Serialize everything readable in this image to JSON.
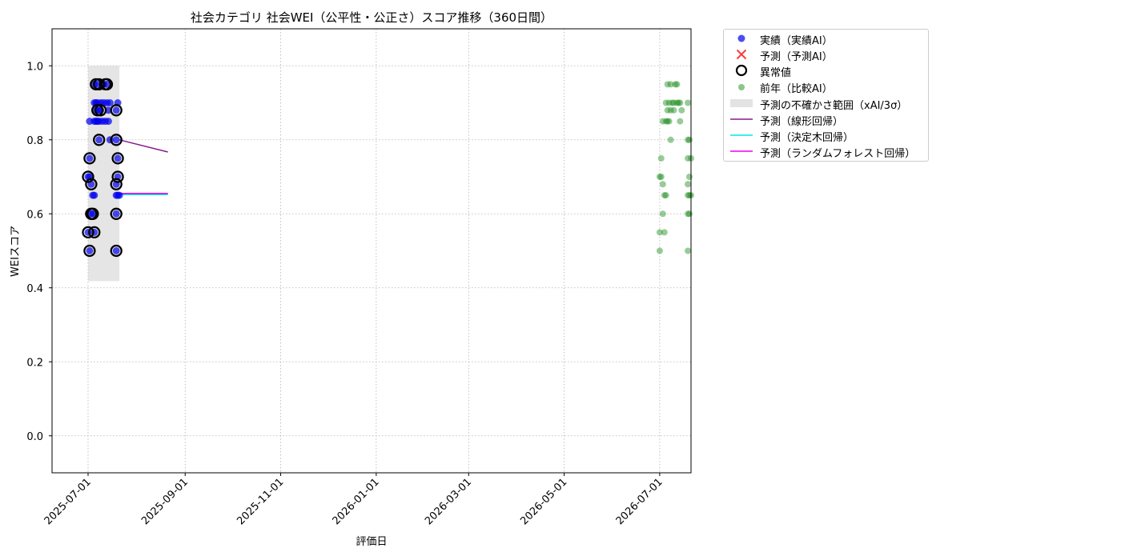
{
  "chart_data": {
    "type": "scatter",
    "title": "社会カテゴリ 社会WEI（公平性・公正さ）スコア推移（360日間）",
    "xlabel": "評価日",
    "ylabel": "WEIスコア",
    "xlim": [
      "2025-06-08",
      "2026-07-21"
    ],
    "ylim": [
      -0.1,
      1.1
    ],
    "x_ticks": [
      "2025-07-01",
      "2025-09-01",
      "2025-11-01",
      "2026-01-01",
      "2026-03-01",
      "2026-05-01",
      "2026-07-01"
    ],
    "y_ticks": [
      0.0,
      0.2,
      0.4,
      0.6,
      0.8,
      1.0
    ],
    "grid": true,
    "legend_position": "outside-top-right",
    "series": [
      {
        "name": "実績（実績AI）",
        "kind": "scatter",
        "color": "#0000ee",
        "points": [
          [
            "2025-07-01",
            0.55
          ],
          [
            "2025-07-01",
            0.7
          ],
          [
            "2025-07-02",
            0.5
          ],
          [
            "2025-07-02",
            0.75
          ],
          [
            "2025-07-02",
            0.7
          ],
          [
            "2025-07-02",
            0.85
          ],
          [
            "2025-07-03",
            0.68
          ],
          [
            "2025-07-03",
            0.6
          ],
          [
            "2025-07-04",
            0.65
          ],
          [
            "2025-07-04",
            0.6
          ],
          [
            "2025-07-05",
            0.65
          ],
          [
            "2025-07-05",
            0.55
          ],
          [
            "2025-07-05",
            0.85
          ],
          [
            "2025-07-05",
            0.9
          ],
          [
            "2025-07-05",
            0.95
          ],
          [
            "2025-07-06",
            0.85
          ],
          [
            "2025-07-06",
            0.9
          ],
          [
            "2025-07-06",
            0.88
          ],
          [
            "2025-07-07",
            0.85
          ],
          [
            "2025-07-07",
            0.9
          ],
          [
            "2025-07-07",
            0.95
          ],
          [
            "2025-07-08",
            0.8
          ],
          [
            "2025-07-08",
            0.88
          ],
          [
            "2025-07-08",
            0.85
          ],
          [
            "2025-07-09",
            0.9
          ],
          [
            "2025-07-09",
            0.88
          ],
          [
            "2025-07-10",
            0.85
          ],
          [
            "2025-07-10",
            0.95
          ],
          [
            "2025-07-11",
            0.9
          ],
          [
            "2025-07-11",
            0.95
          ],
          [
            "2025-07-12",
            0.85
          ],
          [
            "2025-07-13",
            0.9
          ],
          [
            "2025-07-13",
            0.95
          ],
          [
            "2025-07-14",
            0.85
          ],
          [
            "2025-07-14",
            0.88
          ],
          [
            "2025-07-15",
            0.9
          ],
          [
            "2025-07-15",
            0.8
          ],
          [
            "2025-07-19",
            0.65
          ],
          [
            "2025-07-19",
            0.68
          ],
          [
            "2025-07-19",
            0.6
          ],
          [
            "2025-07-19",
            0.5
          ],
          [
            "2025-07-19",
            0.8
          ],
          [
            "2025-07-19",
            0.88
          ],
          [
            "2025-07-20",
            0.75
          ],
          [
            "2025-07-20",
            0.65
          ],
          [
            "2025-07-20",
            0.7
          ],
          [
            "2025-07-20",
            0.9
          ],
          [
            "2025-07-21",
            0.65
          ]
        ]
      },
      {
        "name": "予測（予測AI）",
        "kind": "scatter",
        "color": "#ff3b3b",
        "points": []
      },
      {
        "name": "異常値",
        "kind": "outlier",
        "color": "#000000",
        "points": [
          [
            "2025-07-01",
            0.55
          ],
          [
            "2025-07-01",
            0.7
          ],
          [
            "2025-07-02",
            0.5
          ],
          [
            "2025-07-02",
            0.75
          ],
          [
            "2025-07-03",
            0.68
          ],
          [
            "2025-07-03",
            0.6
          ],
          [
            "2025-07-04",
            0.6
          ],
          [
            "2025-07-05",
            0.55
          ],
          [
            "2025-07-06",
            0.95
          ],
          [
            "2025-07-07",
            0.88
          ],
          [
            "2025-07-08",
            0.8
          ],
          [
            "2025-07-08",
            0.95
          ],
          [
            "2025-07-09",
            0.88
          ],
          [
            "2025-07-12",
            0.95
          ],
          [
            "2025-07-13",
            0.95
          ],
          [
            "2025-07-19",
            0.88
          ],
          [
            "2025-07-19",
            0.8
          ],
          [
            "2025-07-19",
            0.68
          ],
          [
            "2025-07-19",
            0.6
          ],
          [
            "2025-07-19",
            0.5
          ],
          [
            "2025-07-20",
            0.75
          ],
          [
            "2025-07-20",
            0.7
          ]
        ]
      },
      {
        "name": "前年（比較AI）",
        "kind": "scatter",
        "color": "#1a8c1a",
        "points": [
          [
            "2026-07-01",
            0.7
          ],
          [
            "2026-07-01",
            0.55
          ],
          [
            "2026-07-01",
            0.5
          ],
          [
            "2026-07-02",
            0.75
          ],
          [
            "2026-07-02",
            0.7
          ],
          [
            "2026-07-03",
            0.85
          ],
          [
            "2026-07-03",
            0.6
          ],
          [
            "2026-07-03",
            0.68
          ],
          [
            "2026-07-04",
            0.65
          ],
          [
            "2026-07-04",
            0.55
          ],
          [
            "2026-07-05",
            0.85
          ],
          [
            "2026-07-05",
            0.65
          ],
          [
            "2026-07-05",
            0.9
          ],
          [
            "2026-07-06",
            0.95
          ],
          [
            "2026-07-06",
            0.88
          ],
          [
            "2026-07-06",
            0.85
          ],
          [
            "2026-07-07",
            0.9
          ],
          [
            "2026-07-07",
            0.85
          ],
          [
            "2026-07-08",
            0.88
          ],
          [
            "2026-07-08",
            0.8
          ],
          [
            "2026-07-08",
            0.95
          ],
          [
            "2026-07-09",
            0.9
          ],
          [
            "2026-07-10",
            0.88
          ],
          [
            "2026-07-10",
            0.9
          ],
          [
            "2026-07-11",
            0.95
          ],
          [
            "2026-07-12",
            0.9
          ],
          [
            "2026-07-12",
            0.95
          ],
          [
            "2026-07-13",
            0.9
          ],
          [
            "2026-07-14",
            0.85
          ],
          [
            "2026-07-14",
            0.9
          ],
          [
            "2026-07-15",
            0.88
          ],
          [
            "2026-07-19",
            0.8
          ],
          [
            "2026-07-19",
            0.75
          ],
          [
            "2026-07-19",
            0.65
          ],
          [
            "2026-07-19",
            0.68
          ],
          [
            "2026-07-19",
            0.6
          ],
          [
            "2026-07-19",
            0.5
          ],
          [
            "2026-07-19",
            0.9
          ],
          [
            "2026-07-20",
            0.65
          ],
          [
            "2026-07-20",
            0.7
          ],
          [
            "2026-07-20",
            0.6
          ],
          [
            "2026-07-20",
            0.8
          ],
          [
            "2026-07-21",
            0.65
          ],
          [
            "2026-07-21",
            0.75
          ]
        ]
      },
      {
        "name": "予測の不確かさ範囲（xAI/3σ）",
        "kind": "band",
        "color": "#d0d0d0",
        "x_range": [
          "2025-07-01",
          "2025-07-21"
        ],
        "y_range": [
          0.418,
          1.0
        ]
      },
      {
        "name": "予測（線形回帰）",
        "kind": "line",
        "color": "#8b1a8b",
        "points": [
          [
            "2025-07-21",
            0.8
          ],
          [
            "2025-08-21",
            0.767
          ]
        ]
      },
      {
        "name": "予測（決定木回帰）",
        "kind": "line",
        "color": "#00e5ee",
        "points": [
          [
            "2025-07-21",
            0.652
          ],
          [
            "2025-08-21",
            0.652
          ]
        ]
      },
      {
        "name": "予測（ランダムフォレスト回帰）",
        "kind": "line",
        "color": "#ee00ee",
        "points": [
          [
            "2025-07-21",
            0.655
          ],
          [
            "2025-08-21",
            0.655
          ]
        ]
      }
    ]
  }
}
